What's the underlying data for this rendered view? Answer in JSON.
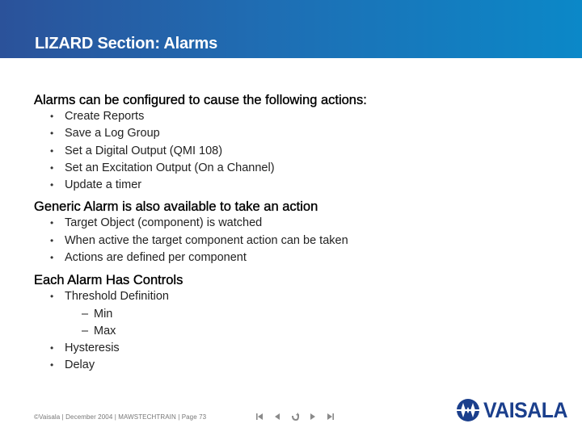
{
  "header": {
    "title": "LIZARD Section: Alarms",
    "gradient_colors": [
      "#2b529a",
      "#0b88c8"
    ]
  },
  "sections": [
    {
      "heading": "Alarms can be configured to cause the following actions:",
      "bullets": [
        {
          "text": "Create Reports"
        },
        {
          "text": "Save a Log Group"
        },
        {
          "text": "Set a Digital Output (QMI 108)"
        },
        {
          "text": "Set an Excitation Output (On a Channel)"
        },
        {
          "text": "Update a timer"
        }
      ]
    },
    {
      "heading": "Generic Alarm is also available to take an action",
      "bullets": [
        {
          "text": "Target Object (component) is watched"
        },
        {
          "text": "When active the target component action can be taken"
        },
        {
          "text": "Actions are defined per component"
        }
      ]
    },
    {
      "heading": "Each Alarm Has Controls",
      "bullets": [
        {
          "text": "Threshold Definition",
          "sub": [
            "Min",
            "Max"
          ]
        },
        {
          "text": "Hysteresis"
        },
        {
          "text": "Delay"
        }
      ]
    }
  ],
  "bullet_glyph": "•",
  "sub_bullet_glyph": "–",
  "footer": {
    "text": "©Vaisala | December 2004 | MAWSTECHTRAIN | Page 73",
    "nav_icons": [
      "first-slide-icon",
      "previous-slide-icon",
      "return-icon",
      "next-slide-icon",
      "last-slide-icon"
    ],
    "nav_color": "#8a8a8a"
  },
  "logo": {
    "text": "VAISALA",
    "color": "#1b3f8c"
  }
}
